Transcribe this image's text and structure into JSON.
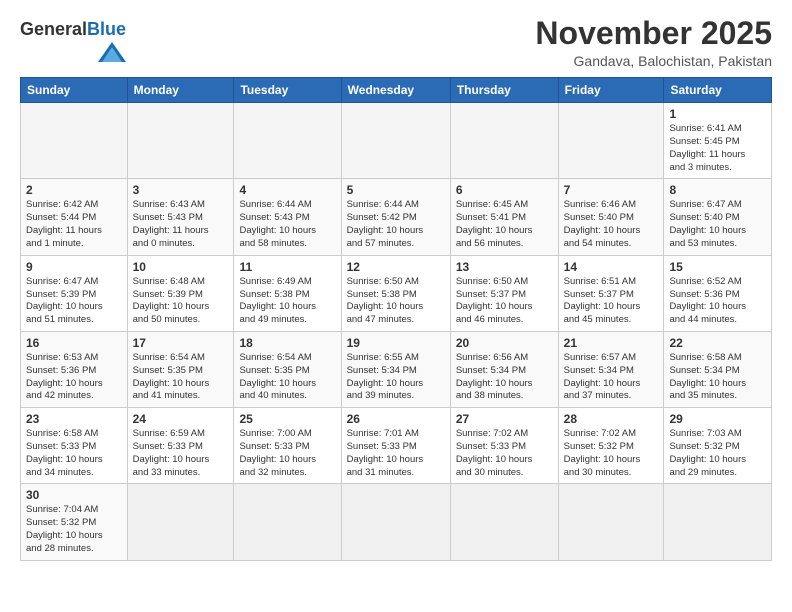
{
  "header": {
    "logo_general": "General",
    "logo_blue": "Blue",
    "month_year": "November 2025",
    "location": "Gandava, Balochistan, Pakistan"
  },
  "days_of_week": [
    "Sunday",
    "Monday",
    "Tuesday",
    "Wednesday",
    "Thursday",
    "Friday",
    "Saturday"
  ],
  "weeks": [
    [
      {
        "day": "",
        "content": ""
      },
      {
        "day": "",
        "content": ""
      },
      {
        "day": "",
        "content": ""
      },
      {
        "day": "",
        "content": ""
      },
      {
        "day": "",
        "content": ""
      },
      {
        "day": "",
        "content": ""
      },
      {
        "day": "1",
        "content": "Sunrise: 6:41 AM\nSunset: 5:45 PM\nDaylight: 11 hours\nand 3 minutes."
      }
    ],
    [
      {
        "day": "2",
        "content": "Sunrise: 6:42 AM\nSunset: 5:44 PM\nDaylight: 11 hours\nand 1 minute."
      },
      {
        "day": "3",
        "content": "Sunrise: 6:43 AM\nSunset: 5:43 PM\nDaylight: 11 hours\nand 0 minutes."
      },
      {
        "day": "4",
        "content": "Sunrise: 6:44 AM\nSunset: 5:43 PM\nDaylight: 10 hours\nand 58 minutes."
      },
      {
        "day": "5",
        "content": "Sunrise: 6:44 AM\nSunset: 5:42 PM\nDaylight: 10 hours\nand 57 minutes."
      },
      {
        "day": "6",
        "content": "Sunrise: 6:45 AM\nSunset: 5:41 PM\nDaylight: 10 hours\nand 56 minutes."
      },
      {
        "day": "7",
        "content": "Sunrise: 6:46 AM\nSunset: 5:40 PM\nDaylight: 10 hours\nand 54 minutes."
      },
      {
        "day": "8",
        "content": "Sunrise: 6:47 AM\nSunset: 5:40 PM\nDaylight: 10 hours\nand 53 minutes."
      }
    ],
    [
      {
        "day": "9",
        "content": "Sunrise: 6:47 AM\nSunset: 5:39 PM\nDaylight: 10 hours\nand 51 minutes."
      },
      {
        "day": "10",
        "content": "Sunrise: 6:48 AM\nSunset: 5:39 PM\nDaylight: 10 hours\nand 50 minutes."
      },
      {
        "day": "11",
        "content": "Sunrise: 6:49 AM\nSunset: 5:38 PM\nDaylight: 10 hours\nand 49 minutes."
      },
      {
        "day": "12",
        "content": "Sunrise: 6:50 AM\nSunset: 5:38 PM\nDaylight: 10 hours\nand 47 minutes."
      },
      {
        "day": "13",
        "content": "Sunrise: 6:50 AM\nSunset: 5:37 PM\nDaylight: 10 hours\nand 46 minutes."
      },
      {
        "day": "14",
        "content": "Sunrise: 6:51 AM\nSunset: 5:37 PM\nDaylight: 10 hours\nand 45 minutes."
      },
      {
        "day": "15",
        "content": "Sunrise: 6:52 AM\nSunset: 5:36 PM\nDaylight: 10 hours\nand 44 minutes."
      }
    ],
    [
      {
        "day": "16",
        "content": "Sunrise: 6:53 AM\nSunset: 5:36 PM\nDaylight: 10 hours\nand 42 minutes."
      },
      {
        "day": "17",
        "content": "Sunrise: 6:54 AM\nSunset: 5:35 PM\nDaylight: 10 hours\nand 41 minutes."
      },
      {
        "day": "18",
        "content": "Sunrise: 6:54 AM\nSunset: 5:35 PM\nDaylight: 10 hours\nand 40 minutes."
      },
      {
        "day": "19",
        "content": "Sunrise: 6:55 AM\nSunset: 5:34 PM\nDaylight: 10 hours\nand 39 minutes."
      },
      {
        "day": "20",
        "content": "Sunrise: 6:56 AM\nSunset: 5:34 PM\nDaylight: 10 hours\nand 38 minutes."
      },
      {
        "day": "21",
        "content": "Sunrise: 6:57 AM\nSunset: 5:34 PM\nDaylight: 10 hours\nand 37 minutes."
      },
      {
        "day": "22",
        "content": "Sunrise: 6:58 AM\nSunset: 5:34 PM\nDaylight: 10 hours\nand 35 minutes."
      }
    ],
    [
      {
        "day": "23",
        "content": "Sunrise: 6:58 AM\nSunset: 5:33 PM\nDaylight: 10 hours\nand 34 minutes."
      },
      {
        "day": "24",
        "content": "Sunrise: 6:59 AM\nSunset: 5:33 PM\nDaylight: 10 hours\nand 33 minutes."
      },
      {
        "day": "25",
        "content": "Sunrise: 7:00 AM\nSunset: 5:33 PM\nDaylight: 10 hours\nand 32 minutes."
      },
      {
        "day": "26",
        "content": "Sunrise: 7:01 AM\nSunset: 5:33 PM\nDaylight: 10 hours\nand 31 minutes."
      },
      {
        "day": "27",
        "content": "Sunrise: 7:02 AM\nSunset: 5:33 PM\nDaylight: 10 hours\nand 30 minutes."
      },
      {
        "day": "28",
        "content": "Sunrise: 7:02 AM\nSunset: 5:32 PM\nDaylight: 10 hours\nand 30 minutes."
      },
      {
        "day": "29",
        "content": "Sunrise: 7:03 AM\nSunset: 5:32 PM\nDaylight: 10 hours\nand 29 minutes."
      }
    ],
    [
      {
        "day": "30",
        "content": "Sunrise: 7:04 AM\nSunset: 5:32 PM\nDaylight: 10 hours\nand 28 minutes."
      },
      {
        "day": "",
        "content": ""
      },
      {
        "day": "",
        "content": ""
      },
      {
        "day": "",
        "content": ""
      },
      {
        "day": "",
        "content": ""
      },
      {
        "day": "",
        "content": ""
      },
      {
        "day": "",
        "content": ""
      }
    ]
  ]
}
